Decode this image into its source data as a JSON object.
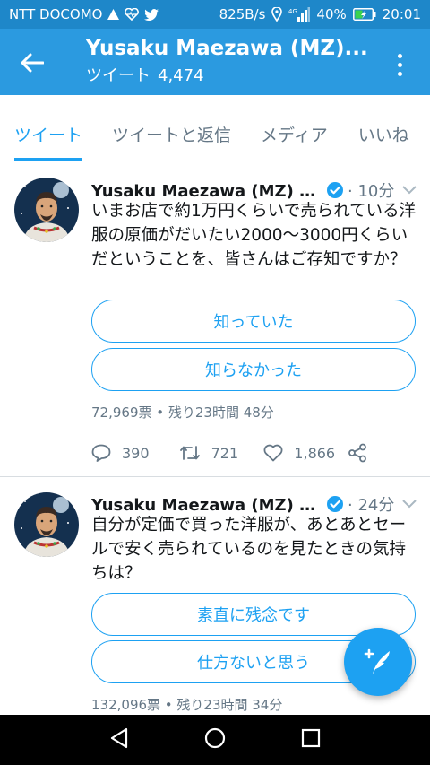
{
  "status_bar": {
    "carrier": "NTT DOCOMO",
    "speed": "825B/s",
    "network": "4G",
    "battery": "40%",
    "time": "20:01"
  },
  "app_bar": {
    "title": "Yusaku Maezawa (MZ)...",
    "subtitle_label": "ツイート",
    "tweet_count": "4,474"
  },
  "tabs": [
    {
      "label": "ツイート",
      "active": true
    },
    {
      "label": "ツイートと返信",
      "active": false
    },
    {
      "label": "メディア",
      "active": false
    },
    {
      "label": "いいね",
      "active": false
    }
  ],
  "tweets": [
    {
      "name": "Yusaku Maezawa (MZ) 前...",
      "time": "· 10分",
      "body": "いまお店で約1万円くらいで売られている洋服の原価がだいたい2000〜3000円くらいだということを、皆さんはご存知ですか？",
      "choices": [
        "知っていた",
        "知らなかった"
      ],
      "poll_meta": "72,969票 • 残り23時間 48分",
      "replies": "390",
      "retweets": "721",
      "likes": "1,866"
    },
    {
      "name": "Yusaku Maezawa (MZ) 前...",
      "time": "· 24分",
      "body": "自分が定価で買った洋服が、あとあとセールで安く売られているのを見たときの気持ちは？",
      "choices": [
        "素直に残念です",
        "仕方ないと思う"
      ],
      "poll_meta": "132,096票 • 残り23時間 34分"
    }
  ],
  "colors": {
    "status_bar": "#1e87c9",
    "app_bar": "#2b9ae0",
    "accent": "#1da1f2",
    "secondary_text": "#657786"
  },
  "icons": [
    "back-arrow-icon",
    "more-vert-icon",
    "verified-icon",
    "chevron-down-icon",
    "reply-icon",
    "retweet-icon",
    "like-icon",
    "share-icon",
    "compose-icon",
    "nav-back-icon",
    "nav-home-icon",
    "nav-recents-icon"
  ]
}
